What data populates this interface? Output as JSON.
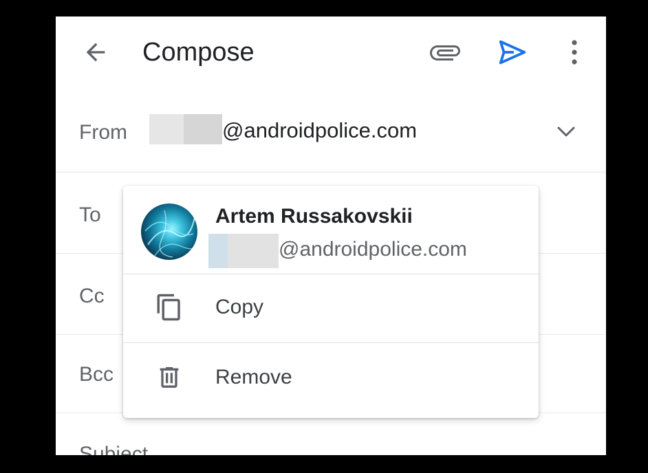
{
  "appbar": {
    "title": "Compose",
    "back_icon": "arrow-back-icon",
    "attach_icon": "paperclip-icon",
    "send_icon": "send-icon",
    "more_icon": "more-vert-icon",
    "send_color": "#1a73e8"
  },
  "fields": {
    "from_label": "From",
    "from_email_suffix": "@androidpolice.com",
    "to_label": "To",
    "cc_label": "Cc",
    "bcc_label": "Bcc",
    "subject_label": "Subject"
  },
  "popup": {
    "contact_name": "Artem Russakovskii",
    "contact_email_suffix": "@androidpolice.com",
    "items": [
      {
        "label": "Copy",
        "icon": "copy-icon"
      },
      {
        "label": "Remove",
        "icon": "trash-icon"
      }
    ]
  }
}
